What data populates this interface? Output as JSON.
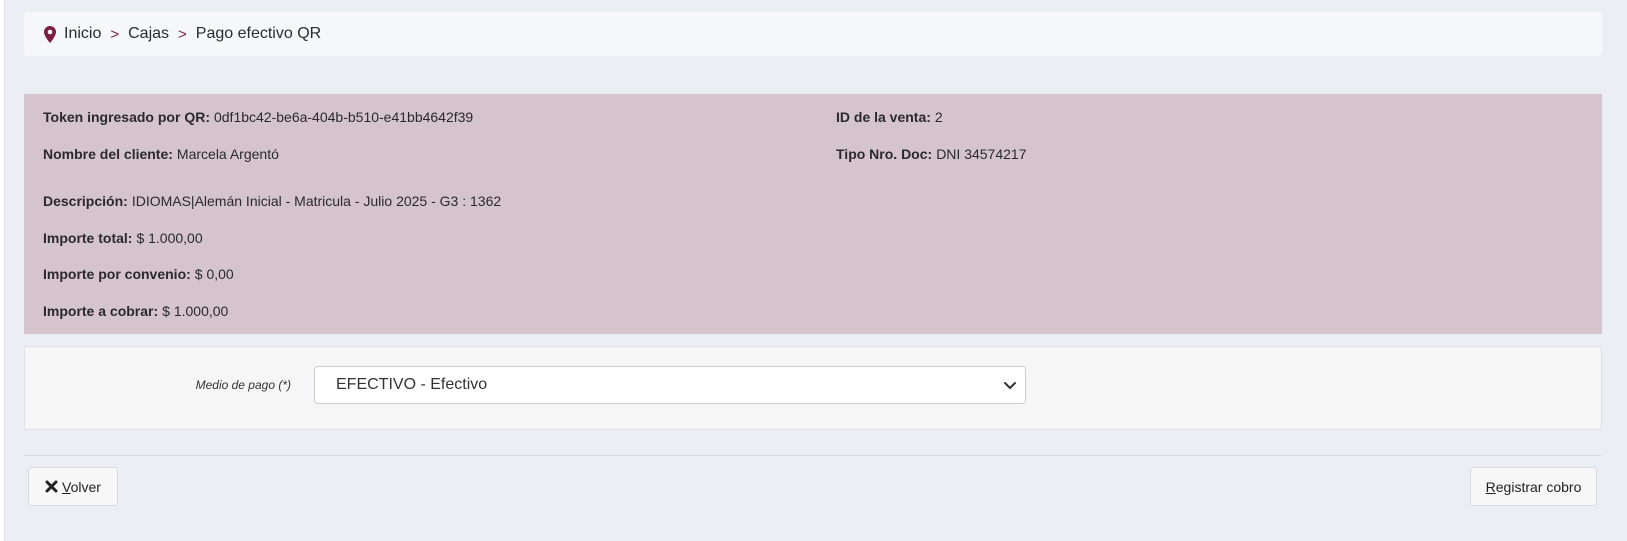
{
  "breadcrumb": {
    "items": [
      "Inicio",
      "Cajas",
      "Pago efectivo QR"
    ],
    "separator": ">"
  },
  "info": {
    "token": {
      "label": "Token ingresado por QR:",
      "value": "0df1bc42-be6a-404b-b510-e41bb4642f39"
    },
    "venta": {
      "label": "ID de la venta:",
      "value": "2"
    },
    "cliente": {
      "label": "Nombre del cliente:",
      "value": "Marcela Argentó"
    },
    "documento": {
      "label": "Tipo Nro. Doc:",
      "value": "DNI 34574217"
    },
    "descripcion": {
      "label": "Descripción:",
      "value": "IDIOMAS|Alemán Inicial - Matricula - Julio 2025 - G3 : 1362"
    },
    "importe_total": {
      "label": "Importe total:",
      "value": "$ 1.000,00"
    },
    "importe_convenio": {
      "label": "Importe por convenio:",
      "value": "$ 0,00"
    },
    "importe_cobrar": {
      "label": "Importe a cobrar:",
      "value": "$ 1.000,00"
    }
  },
  "form": {
    "medio_pago_label": "Medio de pago (*)",
    "medio_pago_value": "EFECTIVO - Efectivo"
  },
  "actions": {
    "volver_label": "Volver",
    "registrar_label": "Registrar cobro"
  },
  "colors": {
    "accent": "#7a1f3d",
    "info_bg": "#d6c4cd",
    "page_bg": "#ebeef3"
  },
  "icons": {
    "breadcrumb": "map-marker-icon",
    "volver": "times-icon",
    "select": "chevron-down-icon"
  }
}
